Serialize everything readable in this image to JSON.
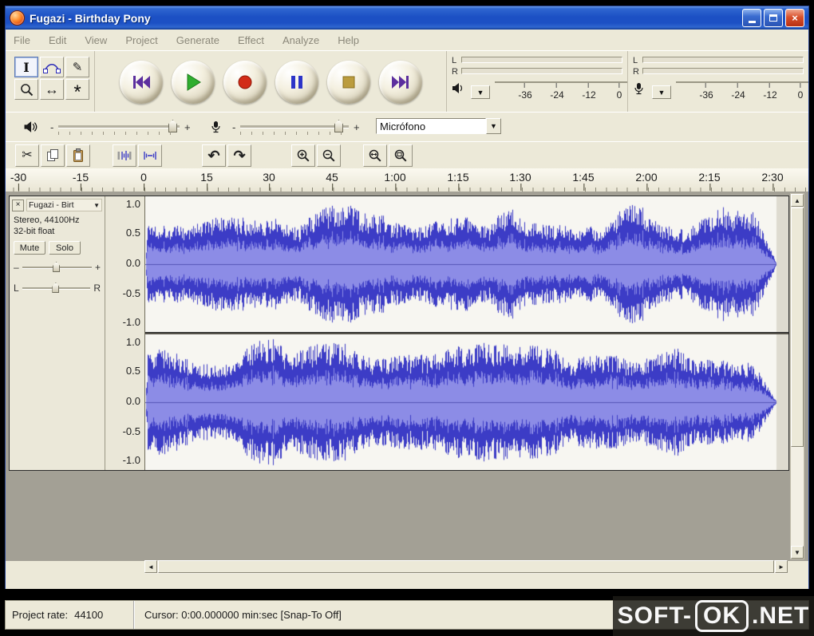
{
  "titlebar": {
    "title": "Fugazi - Birthday Pony",
    "close_glyph": "×"
  },
  "menubar": {
    "items": [
      "File",
      "Edit",
      "View",
      "Project",
      "Generate",
      "Effect",
      "Analyze",
      "Help"
    ]
  },
  "tools": {
    "selection_glyph": "I",
    "draw_glyph": "✎",
    "timeshift_glyph": "↔",
    "multi_glyph": "*"
  },
  "edit_toolbar": {
    "cut_glyph": "✂",
    "undo_glyph": "↶",
    "redo_glyph": "↷"
  },
  "meters": {
    "output": {
      "left_label": "L",
      "right_label": "R",
      "ticks": [
        "-36",
        "-24",
        "-12",
        "0"
      ]
    },
    "input": {
      "left_label": "L",
      "right_label": "R",
      "ticks": [
        "-36",
        "-24",
        "-12",
        "0"
      ]
    }
  },
  "dropdown_arrow": "▼",
  "mixer": {
    "output_minus": "-",
    "output_plus": "+",
    "input_minus": "-",
    "input_plus": "+",
    "device": "Micrófono"
  },
  "timeline": {
    "ticks": [
      "-30",
      "-15",
      "0",
      "15",
      "30",
      "45",
      "1:00",
      "1:15",
      "1:30",
      "1:45",
      "2:00",
      "2:15",
      "2:30"
    ]
  },
  "track": {
    "close_glyph": "×",
    "name": "Fugazi - Birt",
    "menu_arrow": "▼",
    "format_line1": "Stereo, 44100Hz",
    "format_line2": "32-bit float",
    "mute_label": "Mute",
    "solo_label": "Solo",
    "gain_minus": "–",
    "gain_plus": "+",
    "pan_left": "L",
    "pan_right": "R",
    "scale": [
      "1.0",
      "0.5",
      "0.0",
      "-0.5",
      "-1.0"
    ]
  },
  "scrollbars": {
    "up": "▲",
    "down": "▼",
    "left": "◄",
    "right": "►"
  },
  "statusbar": {
    "project_rate_label": "Project rate:",
    "project_rate_value": "44100",
    "cursor_text": "Cursor: 0:00.000000 min:sec  [Snap-To Off]"
  },
  "watermark": {
    "part1": "SOFT-",
    "part2": "OK",
    "part3": ".NET"
  },
  "waveform": {
    "color": "#3c3cc6",
    "rms_color": "#8c8ce6",
    "background": "#f7f6f1",
    "end_color": "#dedbd0"
  }
}
